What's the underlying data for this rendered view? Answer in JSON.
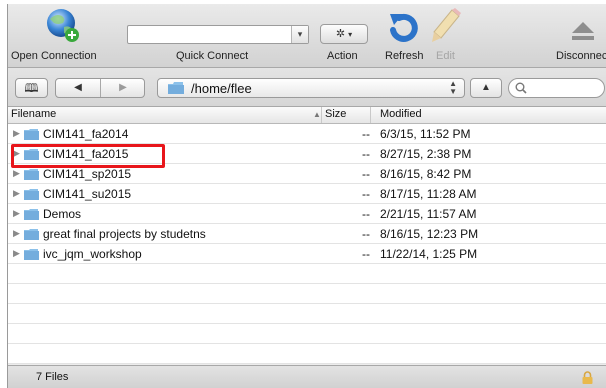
{
  "toolbar": {
    "open_connection": "Open Connection",
    "quick_connect": "Quick Connect",
    "action": "Action",
    "refresh": "Refresh",
    "edit": "Edit",
    "disconnect": "Disconnect"
  },
  "pathbar": {
    "path": "/home/flee"
  },
  "columns": {
    "filename": "Filename",
    "size": "Size",
    "modified": "Modified"
  },
  "files": [
    {
      "name": "CIM141_fa2014",
      "size": "--",
      "modified": "6/3/15, 11:52 PM"
    },
    {
      "name": "CIM141_fa2015",
      "size": "--",
      "modified": "8/27/15, 2:38 PM"
    },
    {
      "name": "CIM141_sp2015",
      "size": "--",
      "modified": "8/16/15, 8:42 PM"
    },
    {
      "name": "CIM141_su2015",
      "size": "--",
      "modified": "8/17/15, 11:28 AM"
    },
    {
      "name": "Demos",
      "size": "--",
      "modified": "2/21/15, 11:57 AM"
    },
    {
      "name": "great final projects by studetns",
      "size": "--",
      "modified": "8/16/15, 12:23 PM"
    },
    {
      "name": "ivc_jqm_workshop",
      "size": "--",
      "modified": "11/22/14, 1:25 PM"
    }
  ],
  "status": {
    "count": "7 Files"
  },
  "icons": {
    "open_connection": "globe-plus-icon",
    "action": "gear-icon",
    "refresh": "refresh-icon",
    "edit": "pencil-icon",
    "disconnect": "eject-icon",
    "bookmarks": "book-icon",
    "back": "back-arrow-icon",
    "forward": "forward-arrow-icon",
    "up": "up-arrow-icon",
    "search": "search-icon",
    "folder": "folder-icon",
    "lock": "lock-icon"
  },
  "colors": {
    "highlight": "#e8161b",
    "folder": "#8cc1ea"
  }
}
